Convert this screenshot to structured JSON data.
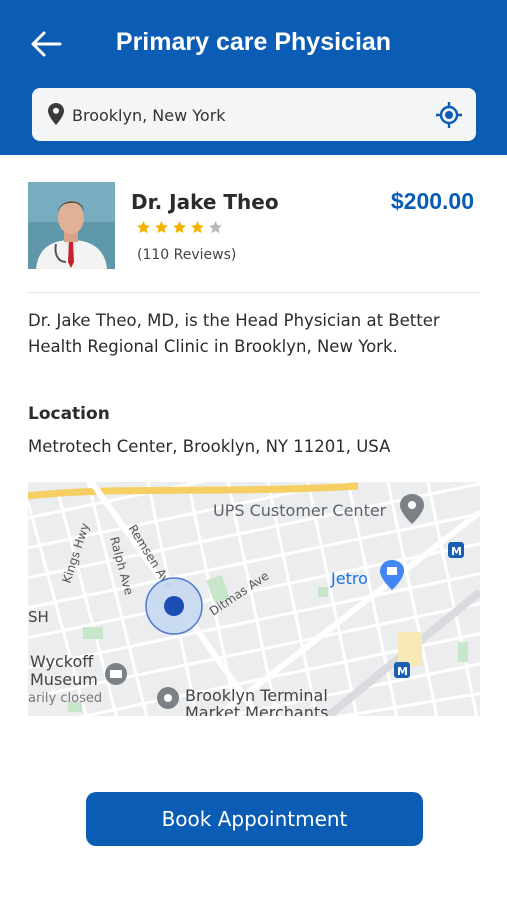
{
  "header": {
    "title": "Primary care Physician",
    "back_icon": "arrow-left-icon",
    "background": "#0b5cb5"
  },
  "search": {
    "value": "Brooklyn, New York",
    "pin_icon": "map-pin-icon",
    "locate_icon": "crosshair-locate-icon"
  },
  "doctor": {
    "name": "Dr. Jake Theo",
    "price": "$200.00",
    "rating": 4,
    "rating_max": 5,
    "reviews": "(110 Reviews)",
    "bio": "Dr. Jake Theo, MD, is the Head Physician at Better Health Regional Clinic in Brooklyn, New York."
  },
  "location": {
    "heading": "Location",
    "address": "Metrotech Center, Brooklyn, NY 11201, USA"
  },
  "map": {
    "labels": {
      "ups": "UPS Customer Center",
      "jetro": "Jetro",
      "remsen": "Remsen Ave",
      "ralph": "Ralph Ave",
      "kings": "Kings Hwy",
      "ditmas": "Ditmas Ave",
      "sh": "SH",
      "wyckoff1": "Wyckoff",
      "wyckoff2": "Museum",
      "closed": "arily closed",
      "terminal1": "Brooklyn Terminal",
      "terminal2": "Market Merchants",
      "metro": "M"
    }
  },
  "actions": {
    "book_label": "Book Appointment"
  },
  "colors": {
    "accent": "#0b5cb5",
    "star": "#f5b301",
    "star_empty": "#b8b8b8"
  }
}
